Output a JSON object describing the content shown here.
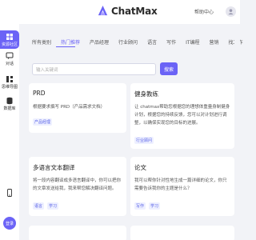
{
  "header": {
    "brand_name": "ChatMax",
    "help_label": "帮助中心",
    "brand_color": "#6b63f6"
  },
  "sidebar": {
    "items": [
      {
        "label": "资源社区",
        "icon": "grid-icon"
      },
      {
        "label": "对话",
        "icon": "chat-icon"
      },
      {
        "label": "思维导图",
        "icon": "mindmap-icon"
      },
      {
        "label": "数据库",
        "icon": "database-icon"
      }
    ],
    "bottom_icon": "phone-icon",
    "login_label": "登录"
  },
  "tabs": [
    {
      "label": "所有类别",
      "active": false
    },
    {
      "label": "热门推荐",
      "active": true
    },
    {
      "label": "产品经理",
      "active": false
    },
    {
      "label": "行业顾问",
      "active": false
    },
    {
      "label": "语言",
      "active": false
    },
    {
      "label": "写作",
      "active": false
    },
    {
      "label": "IT编程",
      "active": false
    },
    {
      "label": "营销",
      "active": false
    },
    {
      "label": "找工作",
      "active": false
    }
  ],
  "search": {
    "placeholder": "输入关键词",
    "button_label": "搜索"
  },
  "cards": [
    {
      "title": "PRD",
      "desc": "根据要求撰写 PRD（产品需求文档）",
      "tags": [
        "产品经理"
      ]
    },
    {
      "title": "健身教练",
      "desc": "让 chatmax帮助您根据您的理想体重量身制健身计划，根据您的持续反馈，您可以对计划进行调整，以确保实现您的目标的进展。",
      "tags": [
        "行业顾问"
      ]
    },
    {
      "title": "多语言文本翻译",
      "desc": "将一段内容翻译成多语言翻译中，你可以把你的文章发送给我，我来帮您解决翻译问题。",
      "tags": [
        "语言",
        "学习"
      ]
    },
    {
      "title": "论文",
      "desc": "我可以帮你针对性地生成一篇详细的论文，你只需要告诉我你的主题是什么？",
      "tags": [
        "写作",
        "学习"
      ]
    }
  ]
}
